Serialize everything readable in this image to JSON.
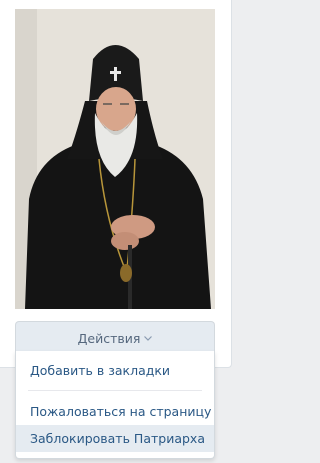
{
  "actions": {
    "label": "Действия",
    "menu": {
      "items": [
        {
          "label": "Добавить в закладки"
        },
        {
          "label": "Пожаловаться на страницу"
        },
        {
          "label": "Заблокировать Патриарха"
        }
      ]
    }
  },
  "colors": {
    "button_bg": "#e5ebf1",
    "button_text": "#55677d",
    "link_text": "#2a5885",
    "hover_bg": "#e5ebf1"
  }
}
